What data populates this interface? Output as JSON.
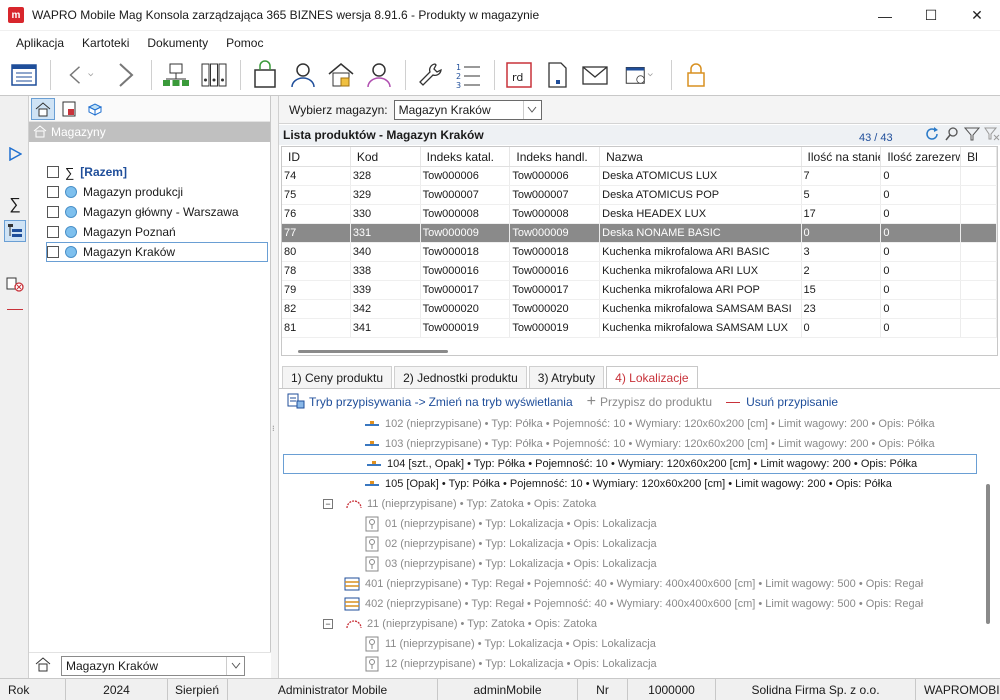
{
  "window": {
    "logo": "m",
    "title": "WAPRO Mobile Mag Konsola zarządzająca 365 BIZNES wersja 8.91.6 - Produkty w magazynie",
    "minimize": "—",
    "maximize": "☐",
    "close": "✕"
  },
  "menu": [
    "Aplikacja",
    "Kartoteki",
    "Dokumenty",
    "Pomoc"
  ],
  "toolbar": {
    "rd_label": "rd"
  },
  "left": {
    "header": "Magazyny",
    "items": [
      {
        "label": "[Razem]",
        "kind": "sum"
      },
      {
        "label": "Magazyn produkcji",
        "kind": "store"
      },
      {
        "label": "Magazyn główny - Warszawa",
        "kind": "store"
      },
      {
        "label": "Magazyn Poznań",
        "kind": "store"
      },
      {
        "label": "Magazyn Kraków",
        "kind": "store"
      }
    ],
    "bottom_combo": "Magazyn Kraków"
  },
  "selector": {
    "label": "Wybierz magazyn:",
    "value": "Magazyn Kraków"
  },
  "list": {
    "title": "Lista produktów - Magazyn Kraków",
    "counter": "43 / 43",
    "columns": [
      "ID",
      "Kod",
      "Indeks katal.",
      "Indeks handl.",
      "Nazwa",
      "Ilość na stanie",
      "Ilość zarezerw.",
      "Bl"
    ],
    "rows": [
      [
        "74",
        "328",
        "Tow000006",
        "Tow000006",
        "Deska ATOMICUS LUX",
        "7",
        "0",
        ""
      ],
      [
        "75",
        "329",
        "Tow000007",
        "Tow000007",
        "Deska ATOMICUS POP",
        "5",
        "0",
        ""
      ],
      [
        "76",
        "330",
        "Tow000008",
        "Tow000008",
        "Deska HEADEX LUX",
        "17",
        "0",
        ""
      ],
      [
        "77",
        "331",
        "Tow000009",
        "Tow000009",
        "Deska NONAME BASIC",
        "0",
        "0",
        ""
      ],
      [
        "80",
        "340",
        "Tow000018",
        "Tow000018",
        "Kuchenka mikrofalowa ARI BASIC",
        "3",
        "0",
        ""
      ],
      [
        "78",
        "338",
        "Tow000016",
        "Tow000016",
        "Kuchenka mikrofalowa ARI LUX",
        "2",
        "0",
        ""
      ],
      [
        "79",
        "339",
        "Tow000017",
        "Tow000017",
        "Kuchenka mikrofalowa ARI POP",
        "15",
        "0",
        ""
      ],
      [
        "82",
        "342",
        "Tow000020",
        "Tow000020",
        "Kuchenka mikrofalowa SAMSAM BASI",
        "23",
        "0",
        ""
      ],
      [
        "81",
        "341",
        "Tow000019",
        "Tow000019",
        "Kuchenka mikrofalowa SAMSAM LUX",
        "0",
        "0",
        ""
      ]
    ],
    "selected_index": 3
  },
  "tabs": [
    "1) Ceny produktu",
    "2) Jednostki produktu",
    "3) Atrybuty",
    "4) Lokalizacje"
  ],
  "active_tab": 3,
  "loc_tools": {
    "mode": "Tryb przypisywania -> ",
    "switch": "Zmień na tryb wyświetlania",
    "assign": "Przypisz do produktu",
    "remove": "Usuń przypisanie"
  },
  "locations": [
    {
      "text": "102 (nieprzypisane) • Typ: Półka • Pojemność: 10 • Wymiary: 120x60x200 [cm] • Limit wagowy: 200 • Opis: Półka",
      "icon": "shelf",
      "dim": true
    },
    {
      "text": "103 (nieprzypisane) • Typ: Półka • Pojemność: 10 • Wymiary: 120x60x200 [cm] • Limit wagowy: 200 • Opis: Półka",
      "icon": "shelf",
      "dim": true
    },
    {
      "text": "104 [szt., Opak] • Typ: Półka • Pojemność: 10 • Wymiary: 120x60x200 [cm] • Limit wagowy: 200 • Opis: Półka",
      "icon": "shelf",
      "dim": false,
      "selected": true
    },
    {
      "text": "105 [Opak] • Typ: Półka • Pojemność: 10 • Wymiary: 120x60x200 [cm] • Limit wagowy: 200 • Opis: Półka",
      "icon": "shelf",
      "dim": false
    },
    {
      "text": "11 (nieprzypisane) • Typ: Zatoka • Opis: Zatoka",
      "icon": "bay",
      "dim": true,
      "collapse": "−"
    },
    {
      "text": "01 (nieprzypisane) • Typ: Lokalizacja • Opis: Lokalizacja",
      "icon": "loc",
      "dim": true
    },
    {
      "text": "02 (nieprzypisane) • Typ: Lokalizacja • Opis: Lokalizacja",
      "icon": "loc",
      "dim": true
    },
    {
      "text": "03 (nieprzypisane) • Typ: Lokalizacja • Opis: Lokalizacja",
      "icon": "loc",
      "dim": true
    },
    {
      "text": "401 (nieprzypisane) • Typ: Regał • Pojemność: 40 • Wymiary: 400x400x600 [cm] • Limit wagowy: 500 • Opis: Regał",
      "icon": "rack",
      "dim": true
    },
    {
      "text": "402 (nieprzypisane) • Typ: Regał • Pojemność: 40 • Wymiary: 400x400x600 [cm] • Limit wagowy: 500 • Opis: Regał",
      "icon": "rack",
      "dim": true
    },
    {
      "text": "21 (nieprzypisane) • Typ: Zatoka • Opis: Zatoka",
      "icon": "bay",
      "dim": true,
      "collapse": "−"
    },
    {
      "text": "11 (nieprzypisane) • Typ: Lokalizacja • Opis: Lokalizacja",
      "icon": "loc",
      "dim": true
    },
    {
      "text": "12 (nieprzypisane) • Typ: Lokalizacja • Opis: Lokalizacja",
      "icon": "loc",
      "dim": true
    }
  ],
  "status": [
    "Rok",
    "2024",
    "Sierpień",
    "Administrator Mobile",
    "adminMobile",
    "Nr",
    "1000000",
    "Solidna Firma Sp. z o.o.",
    "WAPROMOBI"
  ],
  "colors": {
    "accent": "#6a9fd4",
    "selected_row": "#8a8a8a",
    "active_tab": "#c8323a",
    "link": "#1f4e9a"
  }
}
